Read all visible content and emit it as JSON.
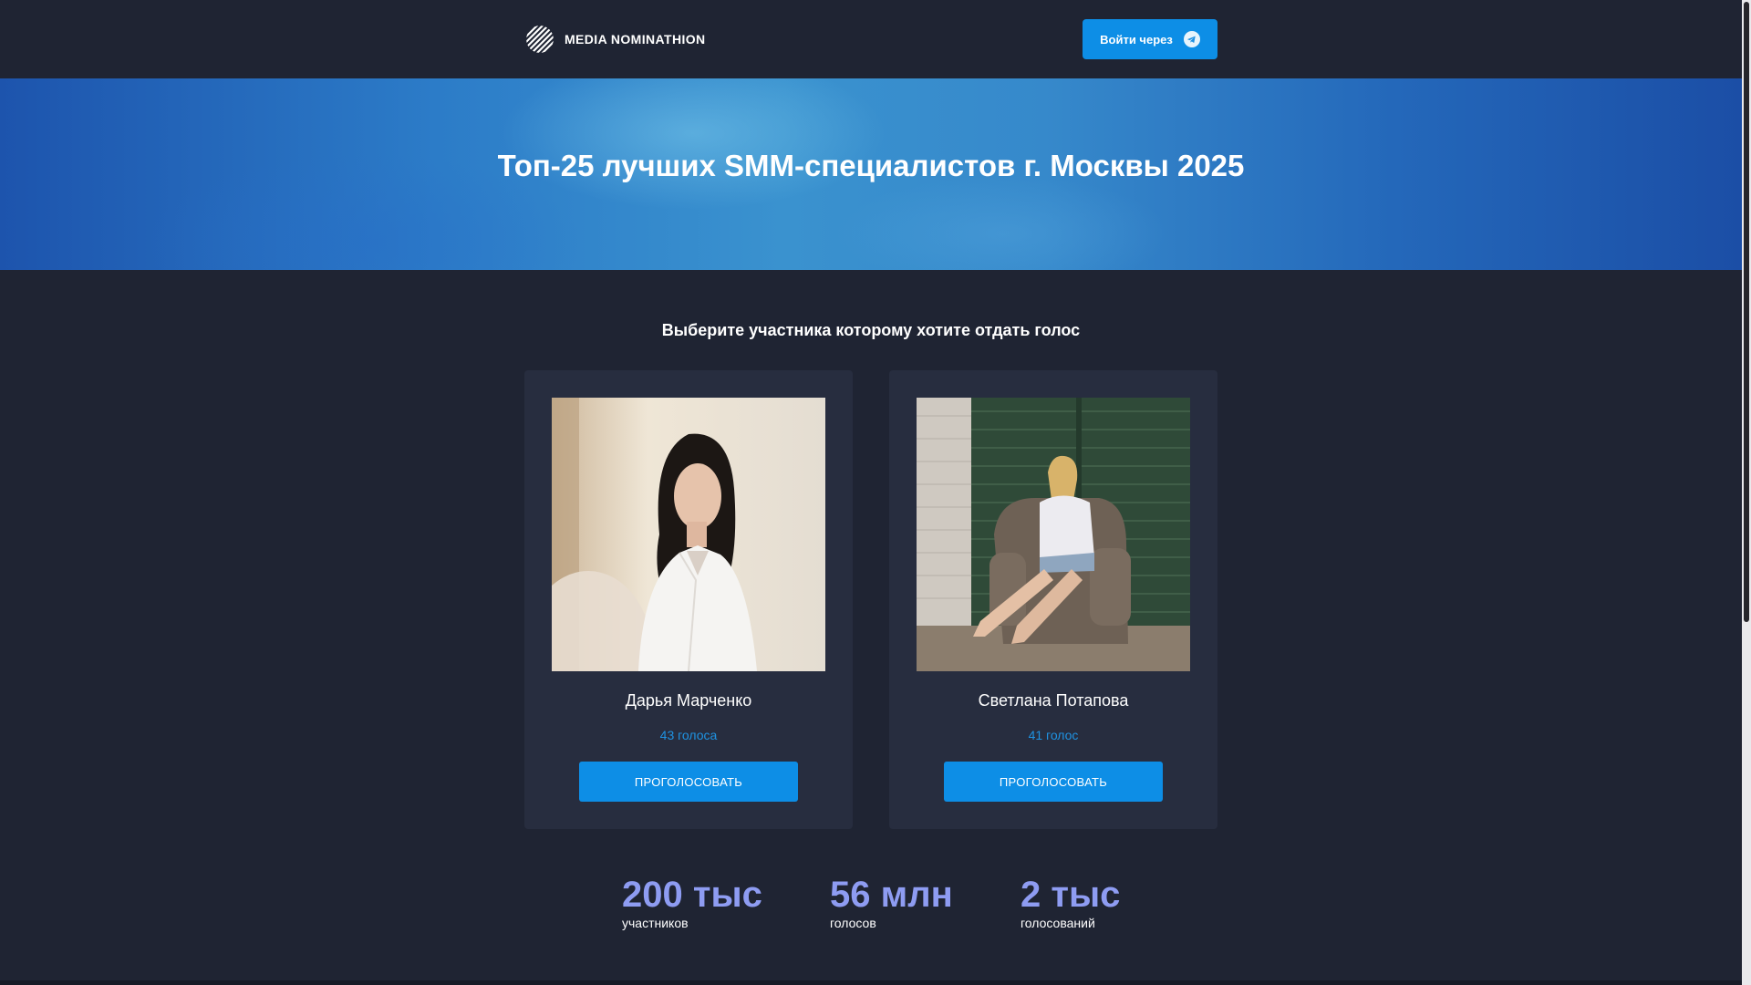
{
  "header": {
    "logo_text": "MEDIA NOMINATHION",
    "logo_icon": "striped-circle-logo",
    "login_label": "Войти через",
    "login_icon": "telegram-icon"
  },
  "banner": {
    "title": "Топ-25 лучших SMM-специалистов г. Москвы 2025"
  },
  "section": {
    "subtitle": "Выберите участника которому хотите отдать голос"
  },
  "candidates": [
    {
      "name": "Дарья Марченко",
      "votes": "43 голоса",
      "button": "ПРОГОЛОСОВАТЬ"
    },
    {
      "name": "Светлана Потапова",
      "votes": "41 голос",
      "button": "ПРОГОЛОСОВАТЬ"
    }
  ],
  "stats": [
    {
      "value": "200 тыс",
      "label": "участников"
    },
    {
      "value": "56 млн",
      "label": "голосов"
    },
    {
      "value": "2 тыс",
      "label": "голосований"
    }
  ],
  "colors": {
    "background": "#1f2433",
    "card": "#272d3f",
    "accent": "#0d8ee6",
    "votes_text": "#1f93e3",
    "stat_value": "#8e9cf2"
  }
}
